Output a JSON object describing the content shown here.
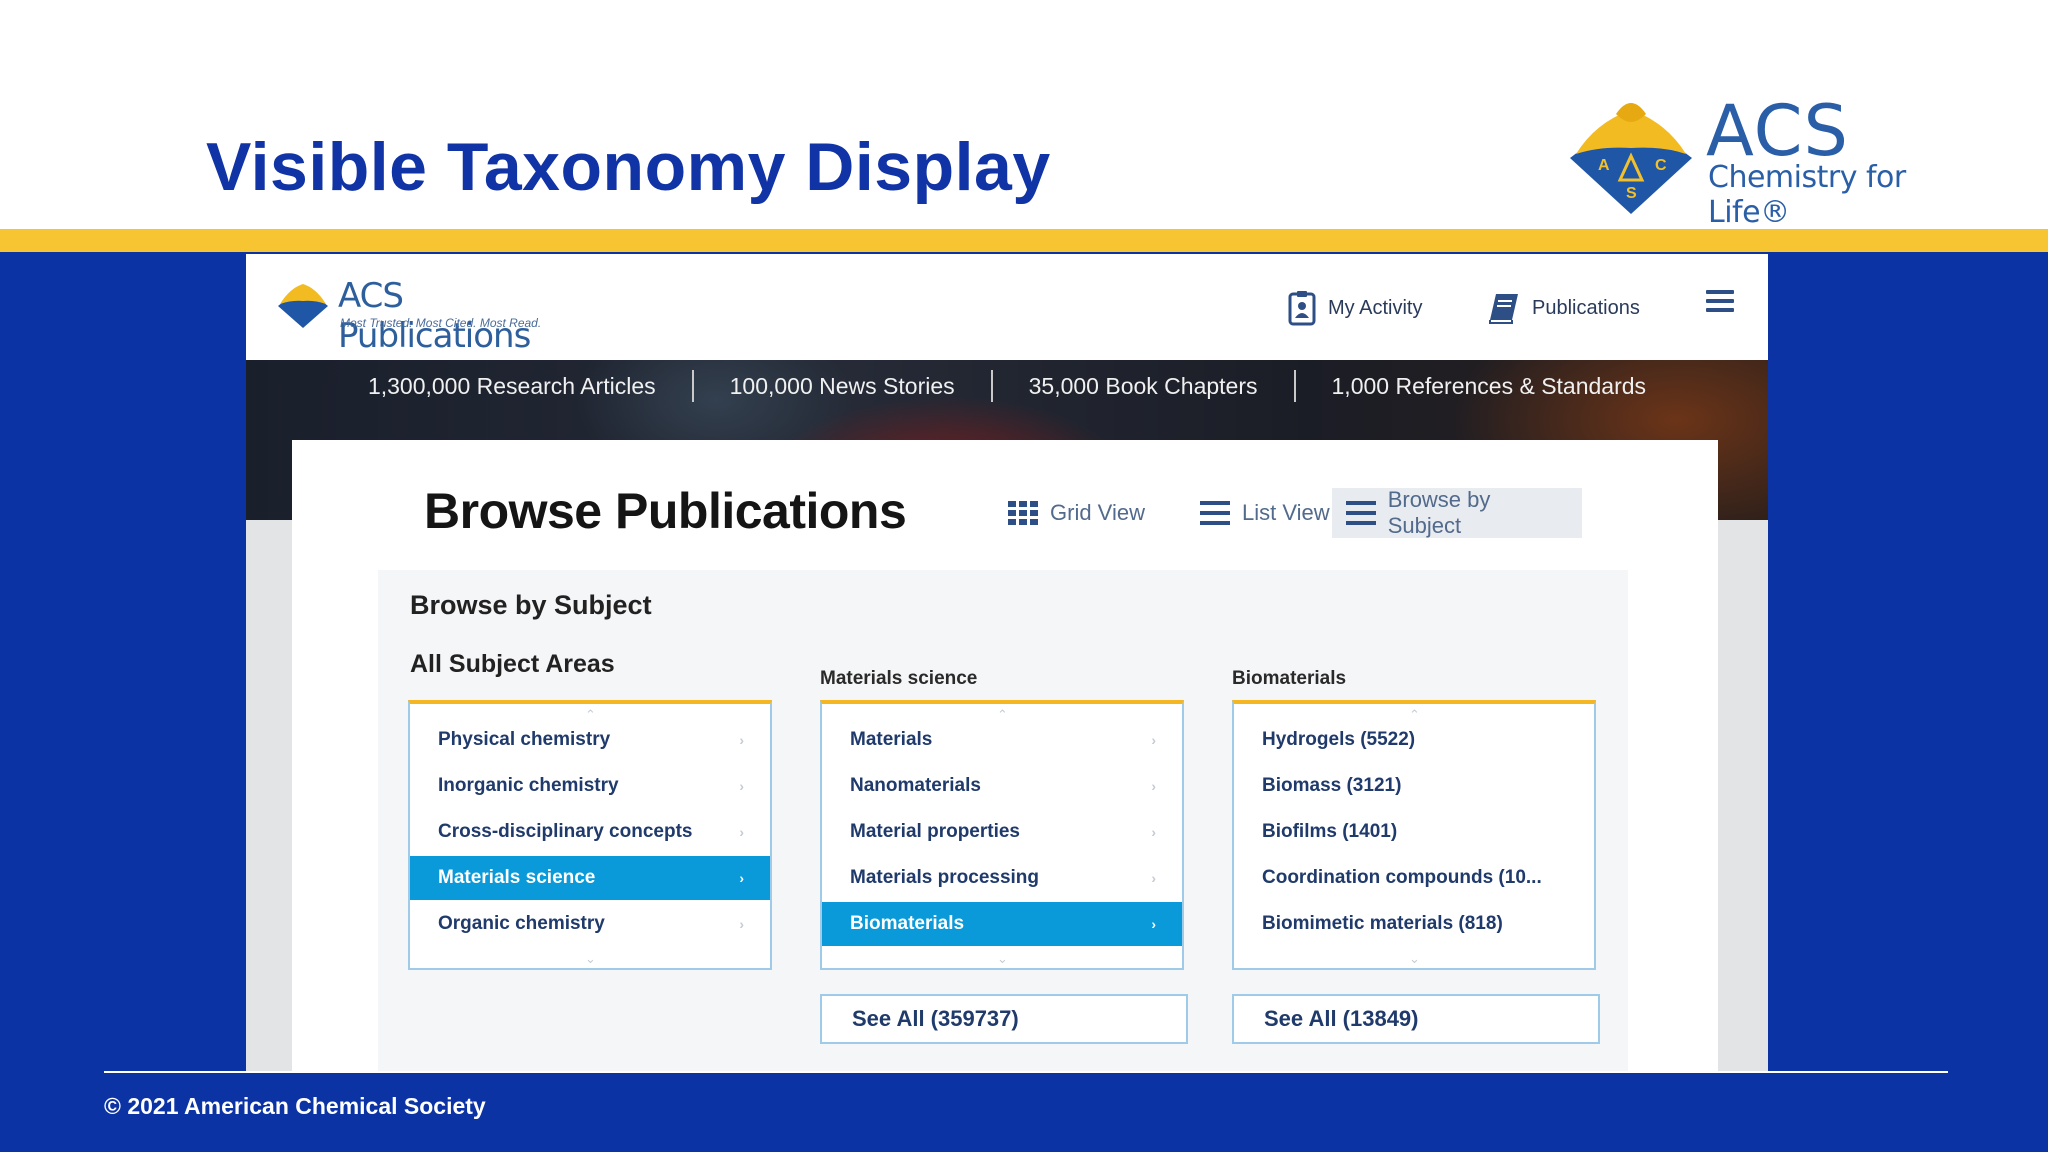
{
  "slide": {
    "title": "Visible Taxonomy Display",
    "copyright": "© 2021 American Chemical Society",
    "colors": {
      "title": "#1033a6",
      "gold": "#f6c531",
      "blue": "#0b33a4"
    }
  },
  "acs_logo": {
    "wordmark": "ACS",
    "tagline": "Chemistry for Life®",
    "emblem_letters": [
      "A",
      "C",
      "S"
    ]
  },
  "pubs_header": {
    "logo_name": "ACS Publications",
    "logo_tagline": "Most Trusted. Most Cited. Most Read.",
    "nav": {
      "my_activity": "My Activity",
      "publications": "Publications"
    },
    "icons": [
      "clipboard-icon",
      "book-icon",
      "hamburger-menu-icon"
    ]
  },
  "stats": [
    "1,300,000 Research Articles",
    "100,000 News Stories",
    "35,000 Book Chapters",
    "1,000 References & Standards"
  ],
  "browse": {
    "title": "Browse Publications",
    "views": {
      "grid": "Grid View",
      "list": "List View",
      "subject": "Browse by Subject"
    },
    "active_view": "subject",
    "panel_heading": "Browse by Subject",
    "all_areas_label": "All Subject Areas",
    "columns": [
      {
        "label": "",
        "items": [
          "Physical chemistry",
          "Inorganic chemistry",
          "Cross-disciplinary concepts",
          "Materials science",
          "Organic chemistry"
        ],
        "selected": 3
      },
      {
        "label": "Materials science",
        "items": [
          "Materials",
          "Nanomaterials",
          "Material properties",
          "Materials processing",
          "Biomaterials"
        ],
        "selected": 4,
        "see_all": "See All (359737)"
      },
      {
        "label": "Biomaterials",
        "items": [
          "Hydrogels (5522)",
          "Biomass (3121)",
          "Biofilms (1401)",
          "Coordination compounds (10...",
          "Biomimetic materials (818)"
        ],
        "selected": -1,
        "see_all": "See All (13849)"
      }
    ]
  }
}
